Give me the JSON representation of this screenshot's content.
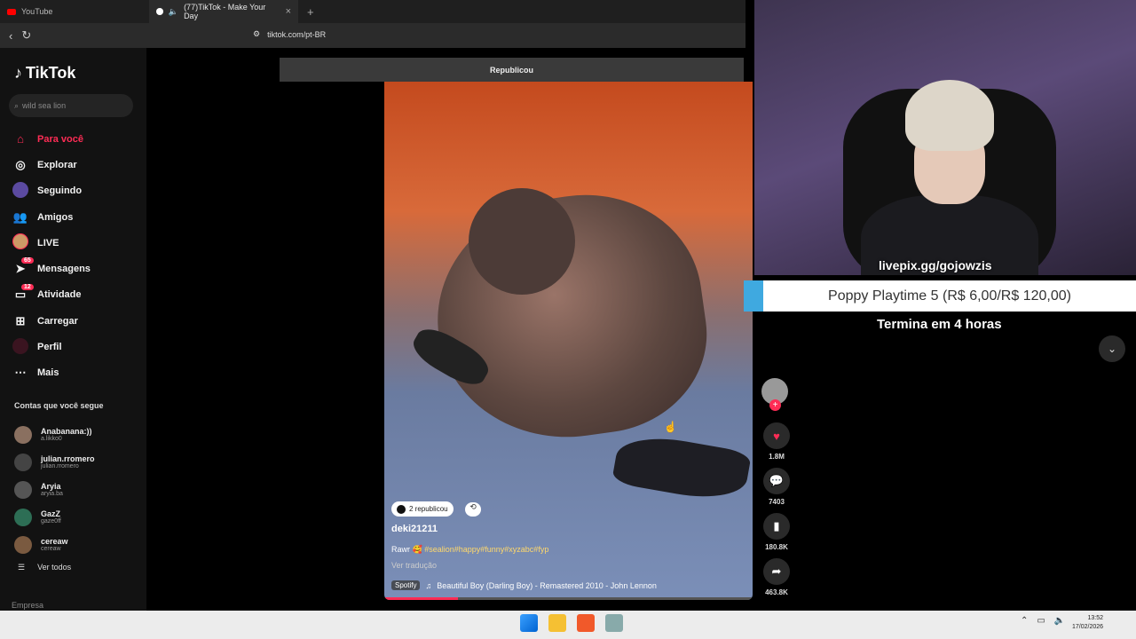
{
  "browser": {
    "tabs": [
      {
        "label": "YouTube",
        "active": false
      },
      {
        "label": "(77)TikTok - Make Your Day",
        "active": true
      }
    ],
    "new_tab": "+",
    "close": "×",
    "url": "tiktok.com/pt-BR"
  },
  "sidebar": {
    "logo": "TikTok",
    "search_placeholder": "wild sea lion",
    "nav": [
      {
        "label": "Para você",
        "icon": "home-icon",
        "active": true
      },
      {
        "label": "Explorar",
        "icon": "compass-icon"
      },
      {
        "label": "Seguindo",
        "icon": "following-icon"
      },
      {
        "label": "Amigos",
        "icon": "friends-icon"
      },
      {
        "label": "LIVE",
        "icon": "live-icon"
      },
      {
        "label": "Mensagens",
        "icon": "messages-icon",
        "badge": "65"
      },
      {
        "label": "Atividade",
        "icon": "activity-icon",
        "badge": "12"
      },
      {
        "label": "Carregar",
        "icon": "upload-icon"
      },
      {
        "label": "Perfil",
        "icon": "profile-icon"
      },
      {
        "label": "Mais",
        "icon": "more-icon"
      }
    ],
    "following_title": "Contas que você segue",
    "following": [
      {
        "name": "Anabanana:))",
        "handle": "a.likko0"
      },
      {
        "name": "julian.rromero",
        "handle": "julian.rromero"
      },
      {
        "name": "Aryia",
        "handle": "aryia.ba"
      },
      {
        "name": "GazZ",
        "handle": "gaze0ff"
      },
      {
        "name": "cereaw",
        "handle": "cereaw"
      }
    ],
    "see_all": "Ver todos",
    "company": "Empresa"
  },
  "video": {
    "repost_banner": "Republicou",
    "repost_pill": "2 republicou",
    "author": "deki21211",
    "caption_text": "Rawr 🥰 ",
    "caption_tags": "#sealion#happy#funny#xyzabc#fyp",
    "translate": "Ver tradução",
    "music_source": "Spotify",
    "music": "Beautiful Boy (Darling Boy) - Remastered 2010 - John Lennon",
    "progress": 0.2
  },
  "actions": {
    "likes": "1.8M",
    "comments": "7403",
    "saves": "180.8K",
    "shares": "463.8K"
  },
  "overlay": {
    "link": "livepix.gg/gojowzis",
    "poll": "Poppy Playtime 5 (R$ 6,00/R$ 120,00)",
    "ends": "Termina em 4 horas"
  },
  "taskbar": {
    "time": "13:52",
    "date": "17/02/2026"
  },
  "colors": {
    "accent": "#fe2c55",
    "poll_accent": "#3fa9e0"
  }
}
